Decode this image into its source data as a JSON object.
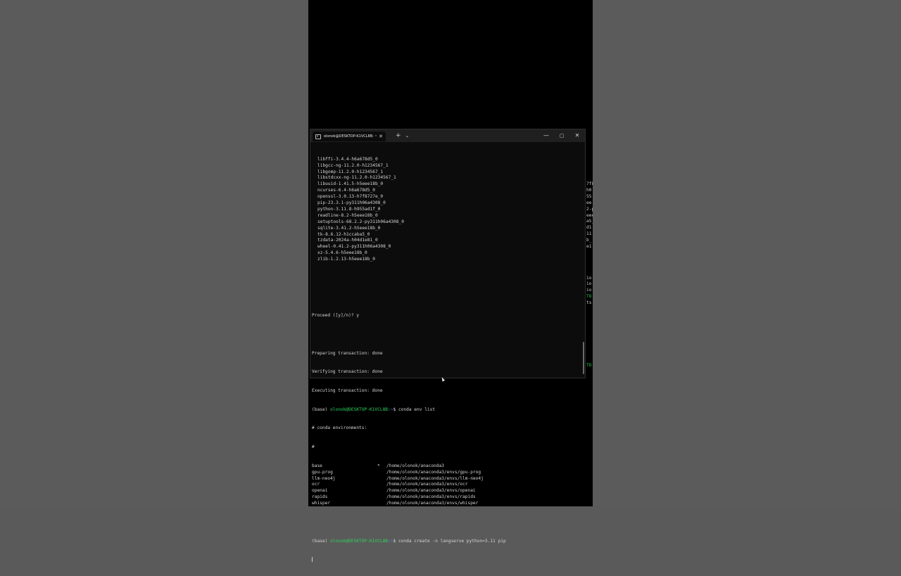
{
  "window": {
    "tab_title": "olonok@DESKTOP-K1VCL8B: ~",
    "tab_close": "✕",
    "new_tab": "+",
    "dropdown": "⌄",
    "minimize": "—",
    "maximize": "▢",
    "close": "✕"
  },
  "terminal": {
    "packages": [
      "libffi-3.4.4-h6a678d5_0",
      "libgcc-ng-11.2.0-h1234567_1",
      "libgomp-11.2.0-h1234567_1",
      "libstdcxx-ng-11.2.0-h1234567_1",
      "libuuid-1.41.5-h5eee18b_0",
      "ncurses-6.4-h6a678d5_0",
      "openssl-3.0.13-h7f8727e_0",
      "pip-23.3.1-py311h06a4308_0",
      "python-3.11.8-h955ad1f_0",
      "readline-8.2-h5eee18b_0",
      "setuptools-68.2.2-py311h06a4308_0",
      "sqlite-3.41.2-h5eee18b_0",
      "tk-8.6.12-h1ccaba5_0",
      "tzdata-2024a-h04d1e81_0",
      "wheel-0.41.2-py311h06a4308_0",
      "xz-5.4.6-h5eee18b_0",
      "zlib-1.2.13-h5eee18b_0"
    ],
    "proceed": "Proceed ([y]/n)? y",
    "preparing": "Preparing transaction: done",
    "verifying": "Verifying transaction: done",
    "executing": "Executing transaction: done",
    "prompt_base": "(base) ",
    "prompt_user": "olonok@DESKTOP-K1VCL8B",
    "prompt_path": ":~",
    "prompt_dollar": "$ ",
    "cmd1": "conda env list",
    "env_header": "# conda environments:",
    "env_hash": "#",
    "envs": [
      {
        "name": "base",
        "marker": "*",
        "path": "/home/olonok/anaconda3"
      },
      {
        "name": "gpu-prog",
        "marker": "",
        "path": "/home/olonok/anaconda3/envs/gpu-prog"
      },
      {
        "name": "llm-neo4j",
        "marker": "",
        "path": "/home/olonok/anaconda3/envs/llm-neo4j"
      },
      {
        "name": "ocr",
        "marker": "",
        "path": "/home/olonok/anaconda3/envs/ocr"
      },
      {
        "name": "openai",
        "marker": "",
        "path": "/home/olonok/anaconda3/envs/openai"
      },
      {
        "name": "rapids",
        "marker": "",
        "path": "/home/olonok/anaconda3/envs/rapids"
      },
      {
        "name": "whisper",
        "marker": "",
        "path": "/home/olonok/anaconda3/envs/whisper"
      }
    ],
    "cmd2": "conda create -n langserve python=3.11 pip"
  },
  "sliver": {
    "fragments": [
      "7f8",
      "h0",
      "55",
      "ee",
      "2-p",
      "eee",
      "a5_",
      "d1",
      "11",
      "b_",
      "e1"
    ],
    "fragments2": [
      "io",
      "io",
      "io"
    ],
    "green1": "TO",
    "tail1": "ts",
    "green2": "TO"
  }
}
